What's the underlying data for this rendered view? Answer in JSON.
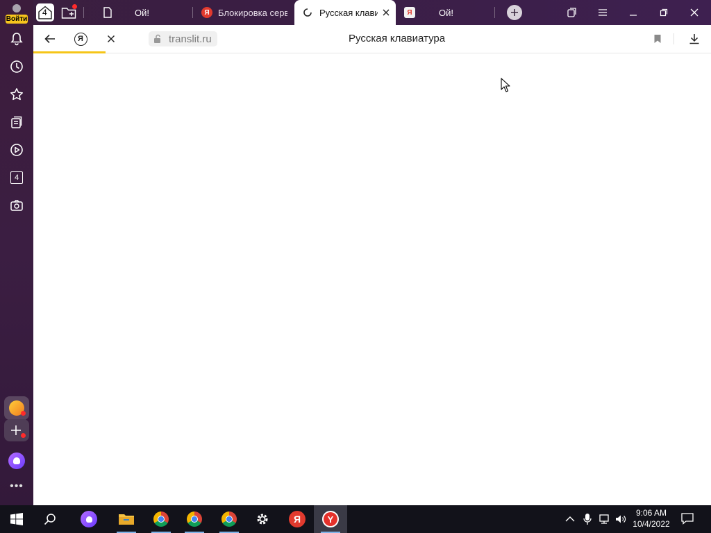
{
  "sidebar": {
    "login_label": "Войти",
    "counter": "4",
    "icons": [
      "bell-icon",
      "history-icon",
      "star-icon",
      "collections-icon",
      "play-icon",
      "tabs-counter-icon",
      "screenshot-icon"
    ],
    "bottom": [
      "mail-icon",
      "add-icon",
      "alice-icon",
      "more-icon"
    ]
  },
  "tabs": {
    "home_counter": "4",
    "items": [
      {
        "label": "Ой!"
      },
      {
        "label": "Блокировка серв"
      },
      {
        "label": "Русская клави"
      },
      {
        "label": "Ой!"
      }
    ]
  },
  "toolbar": {
    "url": "translit.ru",
    "page_title": "Русская клавиатура"
  },
  "taskbar": {
    "time": "9:06 AM",
    "date": "10/4/2022"
  },
  "colors": {
    "accent_yellow": "#f5c518",
    "yandex_red": "#e23a2e"
  }
}
